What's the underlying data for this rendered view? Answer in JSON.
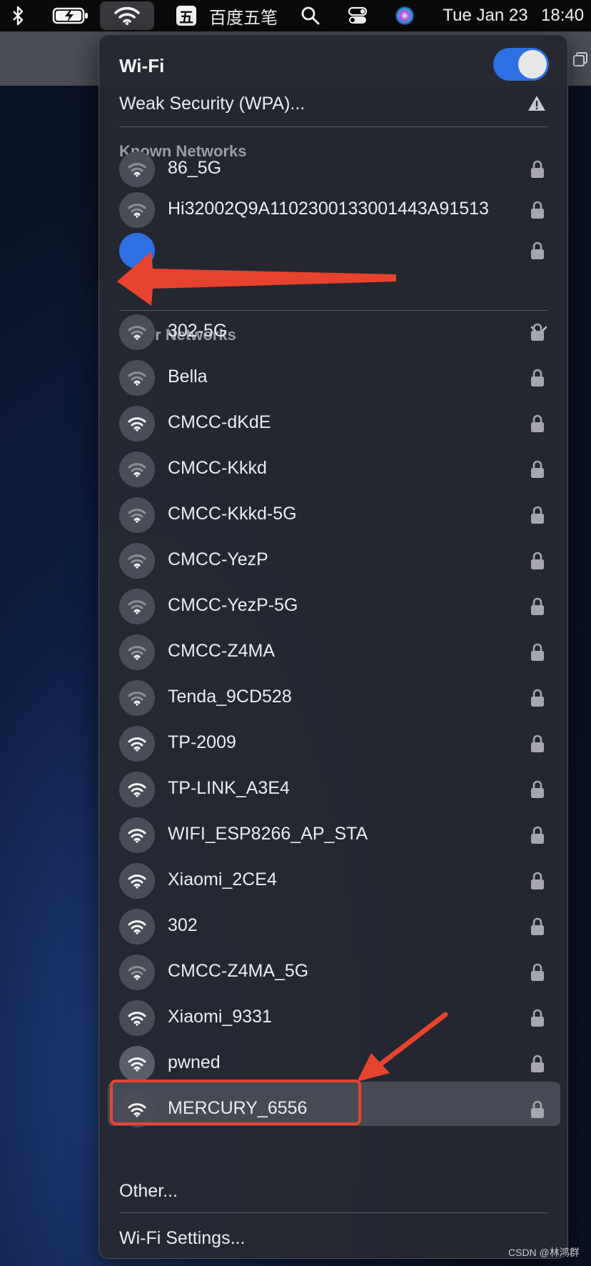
{
  "menubar": {
    "input_method_icon_label": "五",
    "input_method": "百度五笔",
    "date": "Tue Jan 23",
    "time": "18:40"
  },
  "wifi_menu": {
    "title": "Wi-Fi",
    "toggle_on": true,
    "current_network_status": "Weak Security (WPA)...",
    "known_section_label": "Known Networks",
    "known_networks": [
      {
        "name": "86_5G",
        "signal": "weak",
        "locked": true
      },
      {
        "name": "Hi32002Q9A1102300133001443A91513",
        "signal": "weak",
        "locked": true
      },
      {
        "name": "",
        "signal": "connected",
        "locked": true,
        "obscured": true
      }
    ],
    "other_section_label": "Other Networks",
    "other_networks": [
      {
        "name": "302-5G",
        "signal": "weak",
        "locked": true
      },
      {
        "name": "Bella",
        "signal": "weak",
        "locked": true
      },
      {
        "name": "CMCC-dKdE",
        "signal": "strong",
        "locked": true
      },
      {
        "name": "CMCC-Kkkd",
        "signal": "weak",
        "locked": true
      },
      {
        "name": "CMCC-Kkkd-5G",
        "signal": "weak",
        "locked": true
      },
      {
        "name": "CMCC-YezP",
        "signal": "weak",
        "locked": true
      },
      {
        "name": "CMCC-YezP-5G",
        "signal": "weak",
        "locked": true
      },
      {
        "name": "CMCC-Z4MA",
        "signal": "weak",
        "locked": true
      },
      {
        "name": "Tenda_9CD528",
        "signal": "weak",
        "locked": true
      },
      {
        "name": "TP-2009",
        "signal": "strong",
        "locked": true
      },
      {
        "name": "TP-LINK_A3E4",
        "signal": "strong",
        "locked": true
      },
      {
        "name": "WIFI_ESP8266_AP_STA",
        "signal": "strong",
        "locked": true
      },
      {
        "name": "Xiaomi_2CE4",
        "signal": "strong",
        "locked": true
      },
      {
        "name": "302",
        "signal": "strong",
        "locked": true
      },
      {
        "name": "CMCC-Z4MA_5G",
        "signal": "weak",
        "locked": true
      },
      {
        "name": "Xiaomi_9331",
        "signal": "strong",
        "locked": true
      },
      {
        "name": "pwned",
        "signal": "strong",
        "locked": true,
        "highlighted": true
      },
      {
        "name": "MERCURY_6556",
        "signal": "strong",
        "locked": true
      }
    ],
    "other_option": "Other...",
    "settings_link": "Wi-Fi Settings..."
  },
  "watermark": "CSDN @林鸿群",
  "colors": {
    "accent": "#2f6fe4",
    "annotation_red": "#e8432e",
    "panel_bg": "#252831"
  }
}
